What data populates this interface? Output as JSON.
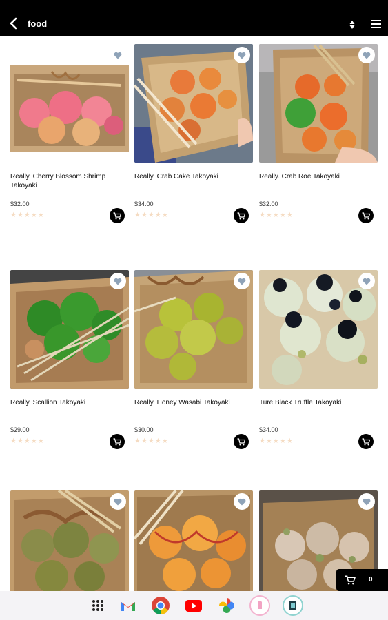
{
  "topbar": {
    "title": "food",
    "back_icon": "chevron-left-icon",
    "sort_icon": "sort-arrows-icon",
    "menu_icon": "hamburger-menu-icon"
  },
  "products": [
    {
      "name": "Really. Cherry Blossom Shrimp Takoyaki",
      "price": "$32.00",
      "rating": 0,
      "photo": "pink-takoyaki-box"
    },
    {
      "name": "Really. Crab Cake Takoyaki",
      "price": "$34.00",
      "rating": 0,
      "photo": "crab-cake-takoyaki-box"
    },
    {
      "name": "Really. Crab Roe Takoyaki",
      "price": "$32.00",
      "rating": 0,
      "photo": "orange-green-roe-takoyaki-box"
    },
    {
      "name": "Really. Scallion Takoyaki",
      "price": "$29.00",
      "rating": 0,
      "photo": "scallion-takoyaki-box"
    },
    {
      "name": "Really. Honey Wasabi Takoyaki",
      "price": "$30.00",
      "rating": 0,
      "photo": "wasabi-takoyaki-box"
    },
    {
      "name": "Ture Black Truffle Takoyaki",
      "price": "$34.00",
      "rating": 0,
      "photo": "black-truffle-takoyaki-box"
    },
    {
      "name": "",
      "price": "",
      "rating": 0,
      "photo": "seaweed-takoyaki-box"
    },
    {
      "name": "",
      "price": "",
      "rating": 0,
      "photo": "spicy-mayo-takoyaki-box"
    },
    {
      "name": "",
      "price": "",
      "rating": 0,
      "photo": "plain-takoyaki-box"
    }
  ],
  "stars_text": "★★★★★",
  "floating_cart": {
    "count": "0"
  },
  "dock": {
    "apps": [
      "app-drawer",
      "gmail",
      "chrome",
      "youtube",
      "photos",
      "app-pink",
      "app-teal"
    ]
  },
  "colors": {
    "topbar": "#000000",
    "fav_heart": "#8fa3b8",
    "star_empty": "#f5dcc3",
    "box": "#c9a77c"
  }
}
